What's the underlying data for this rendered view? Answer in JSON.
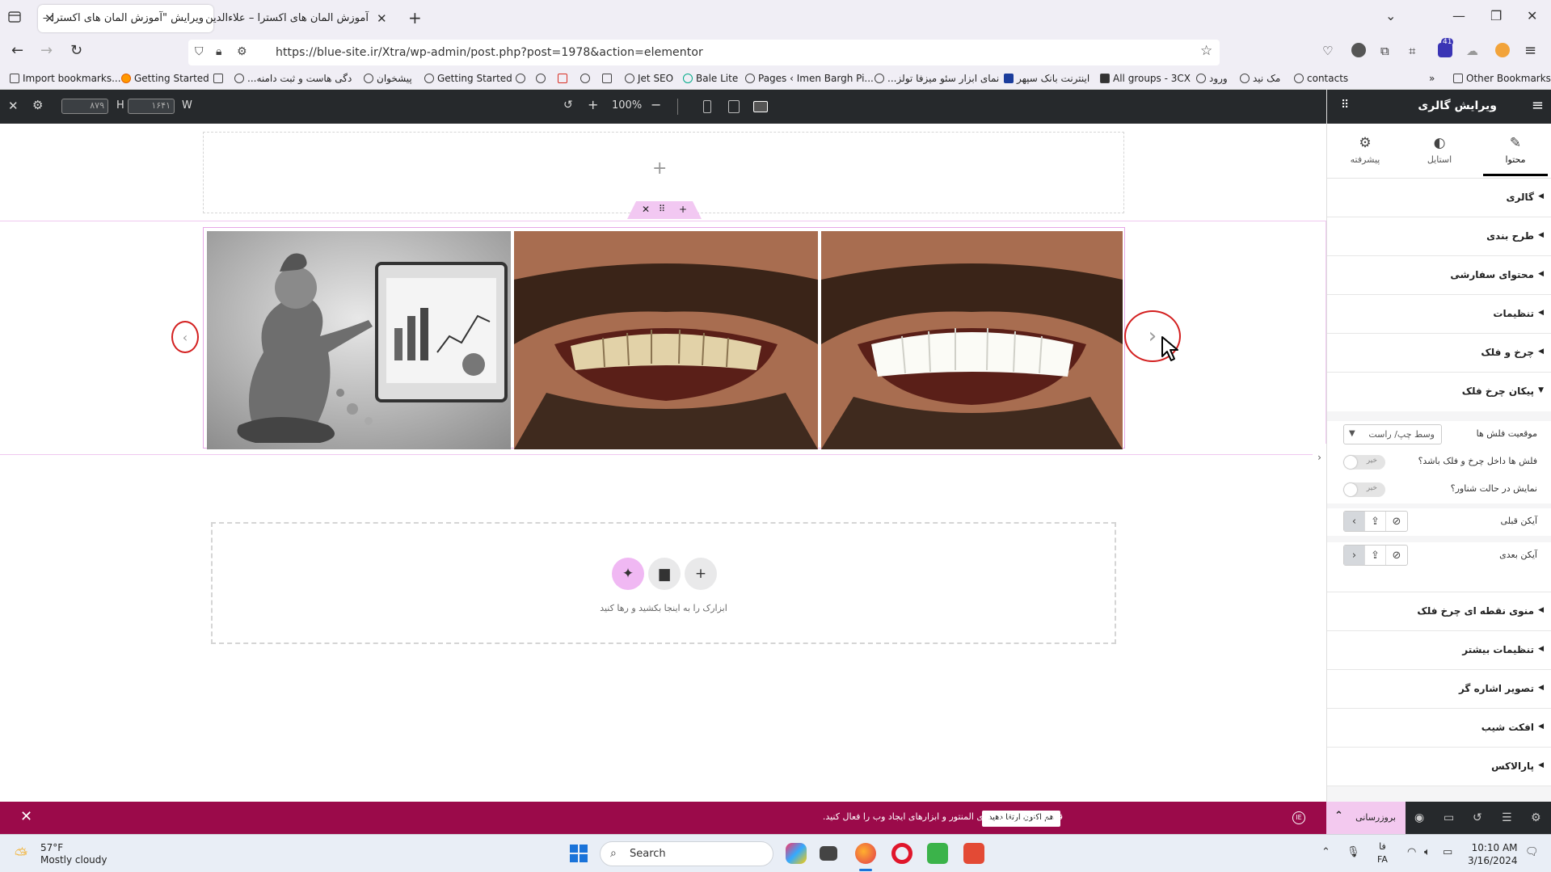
{
  "browser": {
    "tabs": [
      {
        "label": "ویرایش \"آموزش المان های اکسترا –",
        "active": true
      },
      {
        "label": "آموزش المان های اکسترا – علاءالدین",
        "active": false
      }
    ],
    "url": "https://blue-site.ir/Xtra/wp-admin/post.php?post=1978&action=elementor",
    "extension_badge": "41",
    "bookmarks": [
      "Import bookmarks...",
      "Getting Started",
      "...دگی هاست و ثبت دامنه",
      "پیشخوان",
      "Getting Started",
      "Jet SEO",
      "Bale Lite",
      "Pages ‹ Imen Bargh Pi...",
      "...نمای ابزار سئو میزفا تولز",
      "اینترنت بانک سپهر",
      "All groups - 3CX",
      "ورود",
      "مک نید",
      "contacts"
    ],
    "other_bookmarks": "Other Bookmarks"
  },
  "editor_bar": {
    "height_value": "۸۷۹",
    "height_label": "H",
    "width_value": "۱۶۴۱",
    "width_label": "W",
    "zoom": "100%"
  },
  "panel": {
    "title": "ویرایش گالری",
    "tabs": [
      {
        "label": "محتوا",
        "icon": "pencil-icon",
        "active": true
      },
      {
        "label": "استایل",
        "icon": "half-circle-icon",
        "active": false
      },
      {
        "label": "پیشرفته",
        "icon": "gear-icon",
        "active": false
      }
    ],
    "sections_top": [
      "گالری",
      "طرح بندی",
      "محتوای سفارشی",
      "تنظیمات",
      "چرخ و فلک"
    ],
    "open_section": "پیکان چرخ فلک",
    "controls": {
      "arrow_position_label": "موقعیت فلش ها",
      "arrow_position_value": "وسط چپ/ راست",
      "arrows_inside_label": "فلش ها داخل چرخ و فلک باشد؟",
      "arrows_inside_value": "خیر",
      "show_hover_label": "نمایش در حالت شناور؟",
      "show_hover_value": "خیر",
      "prev_icon_label": "آیکن قبلی",
      "next_icon_label": "آیکن بعدی"
    },
    "sections_bottom": [
      "منوی نقطه ای چرخ فلک",
      "تنظیمات بیشتر",
      "تصویر اشاره گر",
      "افکت شیب",
      "پارالاکس"
    ],
    "footer_update": "بروزرسانی"
  },
  "canvas": {
    "drop_text": "ابزارک را به اینجا بکشید و رها کنید"
  },
  "notice": {
    "message": "قدرت کامل ویژگی های المنتور و ابزارهای ایجاد وب را فعال کنید.",
    "button": "هم اکنون ارتقا دهید"
  },
  "taskbar": {
    "temperature": "57°F",
    "weather": "Mostly cloudy",
    "search": "Search",
    "lang": "فا",
    "lang_code": "FA",
    "time": "10:10 AM",
    "date": "3/16/2024"
  },
  "colors": {
    "editor_dark": "#26292c",
    "accent_pink": "#f0b8f3",
    "notice_bg": "#9b0a4a",
    "arrow_circle": "#d31f1f"
  }
}
